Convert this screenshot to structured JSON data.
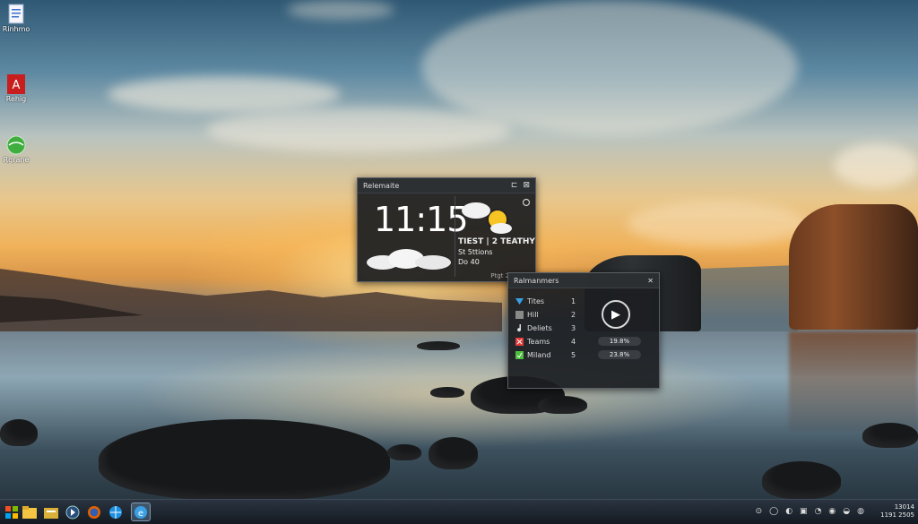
{
  "desktop": {
    "icons": [
      {
        "name": "document",
        "label": "Rinhmo"
      },
      {
        "name": "pdf",
        "label": "Rehig"
      },
      {
        "name": "globe",
        "label": "Rgrane"
      }
    ]
  },
  "weather_widget": {
    "title": "Relemaite",
    "controls": {
      "restore": "⊏",
      "close": "⊠"
    },
    "time": "11:15",
    "headline": "TIEST | 2 TEATHY",
    "line1": "St 5ttions",
    "line2": "Do 40",
    "footer": "Ptgt 2ti 4 6r"
  },
  "media_widget": {
    "title": "Ralmanmers",
    "close": "✕",
    "rows": [
      {
        "label": "Tites",
        "num": "1",
        "color": "#3aa0e6"
      },
      {
        "label": "Hill",
        "num": "2",
        "color": "#8a8a8a"
      },
      {
        "label": "Deliets",
        "num": "3",
        "color": "#dddddd"
      },
      {
        "label": "Teams",
        "num": "4",
        "color": "#e03a3a"
      },
      {
        "label": "Miland",
        "num": "5",
        "color": "#4fbf3f"
      }
    ],
    "pill1": "19.8%",
    "pill2": "23.8%",
    "play": "▶"
  },
  "taskbar": {
    "tray": [
      "⊙",
      "◯",
      "◐",
      "▣",
      "◔",
      "◉",
      "◒",
      "◍"
    ],
    "time": "13014 ",
    "date": "1191 2505"
  }
}
